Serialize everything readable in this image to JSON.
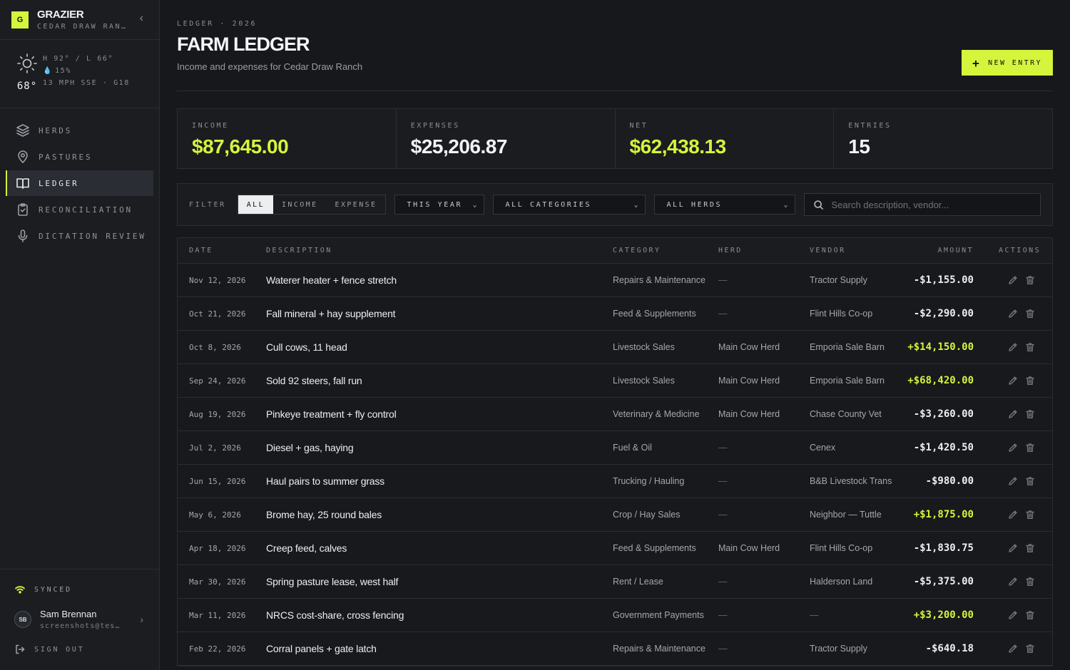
{
  "brand": {
    "logo_letter": "G",
    "name": "GRAZIER",
    "subtitle": "CEDAR DRAW RANCH",
    "collapse_glyph": "‹"
  },
  "weather": {
    "hi_lo": "H 92° / L 66°",
    "precip": "15%",
    "wind": "13 MPH SSE · G18",
    "temp": "68°",
    "icon": "sun-icon"
  },
  "nav": {
    "items": [
      {
        "label": "HERDS",
        "icon": "layers-icon",
        "active": false
      },
      {
        "label": "PASTURES",
        "icon": "map-pin-icon",
        "active": false
      },
      {
        "label": "LEDGER",
        "icon": "book-icon",
        "active": true
      },
      {
        "label": "RECONCILIATION",
        "icon": "clipboard-check-icon",
        "active": false
      },
      {
        "label": "DICTATION REVIEW",
        "icon": "microphone-icon",
        "active": false
      }
    ]
  },
  "footer": {
    "sync_status": "SYNCED",
    "user_initials": "SB",
    "user_name": "Sam Brennan",
    "user_email": "screenshots@test.dev",
    "sign_out": "SIGN OUT"
  },
  "header": {
    "breadcrumb": "LEDGER · 2026",
    "title": "FARM LEDGER",
    "subtitle": "Income and expenses for Cedar Draw Ranch",
    "new_entry_label": "NEW ENTRY"
  },
  "stats": [
    {
      "label": "INCOME",
      "value": "$87,645.00",
      "accent": true
    },
    {
      "label": "EXPENSES",
      "value": "$25,206.87",
      "accent": false
    },
    {
      "label": "NET",
      "value": "$62,438.13",
      "accent": true
    },
    {
      "label": "ENTRIES",
      "value": "15",
      "accent": false
    }
  ],
  "filters": {
    "label": "FILTER",
    "segments": [
      "ALL",
      "INCOME",
      "EXPENSE"
    ],
    "selected_segment": "ALL",
    "period": "THIS YEAR",
    "category": "ALL CATEGORIES",
    "herd": "ALL HERDS",
    "search_placeholder": "Search description, vendor..."
  },
  "table": {
    "columns": [
      "DATE",
      "DESCRIPTION",
      "CATEGORY",
      "HERD",
      "VENDOR",
      "AMOUNT",
      "ACTIONS"
    ],
    "rows": [
      {
        "date": "Nov 12, 2026",
        "description": "Waterer heater + fence stretch",
        "category": "Repairs & Maintenance",
        "herd": "—",
        "vendor": "Tractor Supply",
        "amount": "-$1,155.00",
        "positive": false
      },
      {
        "date": "Oct 21, 2026",
        "description": "Fall mineral + hay supplement",
        "category": "Feed & Supplements",
        "herd": "—",
        "vendor": "Flint Hills Co-op",
        "amount": "-$2,290.00",
        "positive": false
      },
      {
        "date": "Oct 8, 2026",
        "description": "Cull cows, 11 head",
        "category": "Livestock Sales",
        "herd": "Main Cow Herd",
        "vendor": "Emporia Sale Barn",
        "amount": "+$14,150.00",
        "positive": true
      },
      {
        "date": "Sep 24, 2026",
        "description": "Sold 92 steers, fall run",
        "category": "Livestock Sales",
        "herd": "Main Cow Herd",
        "vendor": "Emporia Sale Barn",
        "amount": "+$68,420.00",
        "positive": true
      },
      {
        "date": "Aug 19, 2026",
        "description": "Pinkeye treatment + fly control",
        "category": "Veterinary & Medicine",
        "herd": "Main Cow Herd",
        "vendor": "Chase County Vet",
        "amount": "-$3,260.00",
        "positive": false
      },
      {
        "date": "Jul 2, 2026",
        "description": "Diesel + gas, haying",
        "category": "Fuel & Oil",
        "herd": "—",
        "vendor": "Cenex",
        "amount": "-$1,420.50",
        "positive": false
      },
      {
        "date": "Jun 15, 2026",
        "description": "Haul pairs to summer grass",
        "category": "Trucking / Hauling",
        "herd": "—",
        "vendor": "B&B Livestock Trans",
        "amount": "-$980.00",
        "positive": false
      },
      {
        "date": "May 6, 2026",
        "description": "Brome hay, 25 round bales",
        "category": "Crop / Hay Sales",
        "herd": "—",
        "vendor": "Neighbor — Tuttle",
        "amount": "+$1,875.00",
        "positive": true
      },
      {
        "date": "Apr 18, 2026",
        "description": "Creep feed, calves",
        "category": "Feed & Supplements",
        "herd": "Main Cow Herd",
        "vendor": "Flint Hills Co-op",
        "amount": "-$1,830.75",
        "positive": false
      },
      {
        "date": "Mar 30, 2026",
        "description": "Spring pasture lease, west half",
        "category": "Rent / Lease",
        "herd": "—",
        "vendor": "Halderson Land",
        "amount": "-$5,375.00",
        "positive": false
      },
      {
        "date": "Mar 11, 2026",
        "description": "NRCS cost-share, cross fencing",
        "category": "Government Payments",
        "herd": "—",
        "vendor": "—",
        "amount": "+$3,200.00",
        "positive": true
      },
      {
        "date": "Feb 22, 2026",
        "description": "Corral panels + gate latch",
        "category": "Repairs & Maintenance",
        "herd": "—",
        "vendor": "Tractor Supply",
        "amount": "-$640.18",
        "positive": false
      }
    ]
  },
  "colors": {
    "accent": "#d4f53c",
    "background": "#16181c",
    "sidebar": "#1b1d21",
    "border": "#2a2d32"
  }
}
